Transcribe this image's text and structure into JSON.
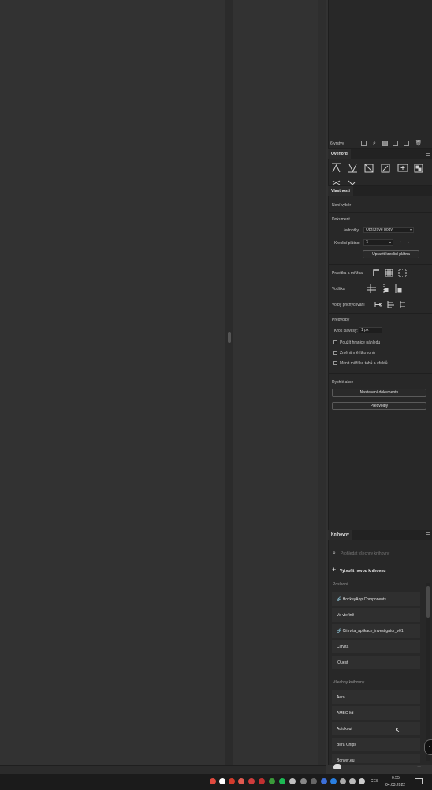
{
  "colors": {
    "panel_bg": "#282828",
    "canvas_bg": "#323232",
    "taskbar_bg": "#1b1b1b"
  },
  "layers": {
    "count_label": "6 vrstvy"
  },
  "overlord": {
    "tab_label": "Overlord"
  },
  "properties": {
    "tab_label": "Vlastnosti",
    "no_selection": "Není výběr",
    "document_heading": "Dokument",
    "units_label": "Jednotky:",
    "units_value": "Obrazové body",
    "artboard_label": "Kreslicí plátno:",
    "artboard_value": "3",
    "edit_artboards_button": "Upravit kreslicí plátna",
    "rulers_grids_label": "Pravítka a mřížka",
    "guides_label": "Vodítka",
    "snap_options_label": "Volby přichycování",
    "preferences_heading": "Předvolby",
    "keyboard_increment_label": "Krok klávesy:",
    "keyboard_increment_value": "1 px",
    "chk_preview_bounds": "Použít hranice náhledu",
    "chk_scale_corners": "Změnit měřítko rohů",
    "chk_scale_strokes": "Měnit měřítko tahů a efektů",
    "quick_actions_heading": "Rychlé akce",
    "document_setup_button": "Nastavení dokumentu",
    "preferences_button": "Předvolby"
  },
  "libraries": {
    "tab_label": "Knihovny",
    "search_placeholder": "Prohledat všechny knihovny",
    "create_new": "Vytvořit novou knihovnu",
    "recent_heading": "Poslední",
    "recent_items": [
      "HockeyApp Components",
      "Ve vteřině",
      "Cii.rvita_aplikace_investigator_v01",
      "Ciirvita",
      "iQuest"
    ],
    "all_heading": "Všechny knihovny",
    "all_items": [
      "Aero",
      "AMBG ltd",
      "Autokout",
      "Birra Chips",
      "Bonver.eu"
    ]
  },
  "taskbar": {
    "language": "CES",
    "time": "0:55",
    "date": "04.03.2022"
  }
}
